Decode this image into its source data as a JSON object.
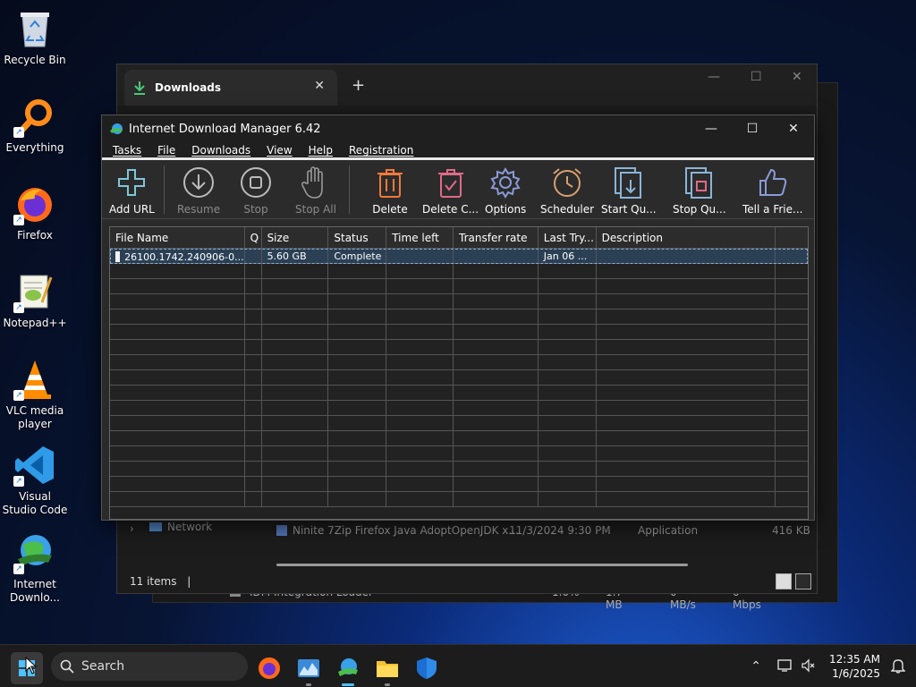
{
  "desktop": {
    "icons": [
      {
        "label": "Recycle Bin"
      },
      {
        "label": "Everything"
      },
      {
        "label": "Firefox"
      },
      {
        "label": "Notepad++"
      },
      {
        "label": "VLC media player"
      },
      {
        "label": "Visual Studio Code"
      },
      {
        "label": "Internet Downlo..."
      }
    ]
  },
  "explorer": {
    "tab_title": "Downloads",
    "status": "11 items",
    "sidebar_item": "Network",
    "file_row": {
      "name": "Ninite 7Zip Firefox Java AdoptOpenJDK x...",
      "date": "11/3/2024 9:30 PM",
      "type": "Application",
      "size": "416 KB"
    },
    "task_row": {
      "name": "IDM Integration Loader",
      "cpu": "1.0%",
      "mem": "1.7 MB",
      "disk": "0 MB/s",
      "net": "0 Mbps"
    }
  },
  "idm": {
    "title": "Internet Download Manager 6.42",
    "menu": [
      "Tasks",
      "File",
      "Downloads",
      "View",
      "Help",
      "Registration"
    ],
    "toolbar": [
      {
        "label": "Add URL",
        "icon": "plus-icon",
        "enabled": true
      },
      {
        "label": "Resume",
        "icon": "download-arrow-icon",
        "enabled": false
      },
      {
        "label": "Stop",
        "icon": "stop-icon",
        "enabled": false
      },
      {
        "label": "Stop All",
        "icon": "hand-icon",
        "enabled": false
      },
      {
        "label": "Delete",
        "icon": "trash-icon",
        "enabled": true
      },
      {
        "label": "Delete C...",
        "icon": "trash-check-icon",
        "enabled": true
      },
      {
        "label": "Options",
        "icon": "gear-icon",
        "enabled": true
      },
      {
        "label": "Scheduler",
        "icon": "alarm-clock-icon",
        "enabled": true
      },
      {
        "label": "Start Qu...",
        "icon": "start-queue-icon",
        "enabled": true
      },
      {
        "label": "Stop Qu...",
        "icon": "stop-queue-icon",
        "enabled": true
      },
      {
        "label": "Tell a Frie...",
        "icon": "thumbs-up-icon",
        "enabled": true
      }
    ],
    "columns": [
      "File Name",
      "Q",
      "Size",
      "Status",
      "Time left",
      "Transfer rate",
      "Last Try...",
      "Description"
    ],
    "rows": [
      {
        "file": "26100.1742.240906-0...",
        "q": "",
        "size": "5.60  GB",
        "status": "Complete",
        "time_left": "",
        "rate": "",
        "last_try": "Jan 06 ...",
        "description": ""
      }
    ]
  },
  "taskbar": {
    "search_placeholder": "Search",
    "time": "12:35 AM",
    "date": "1/6/2025"
  },
  "colors": {
    "accent": "#4cc2ff",
    "selection": "#2b4055"
  }
}
